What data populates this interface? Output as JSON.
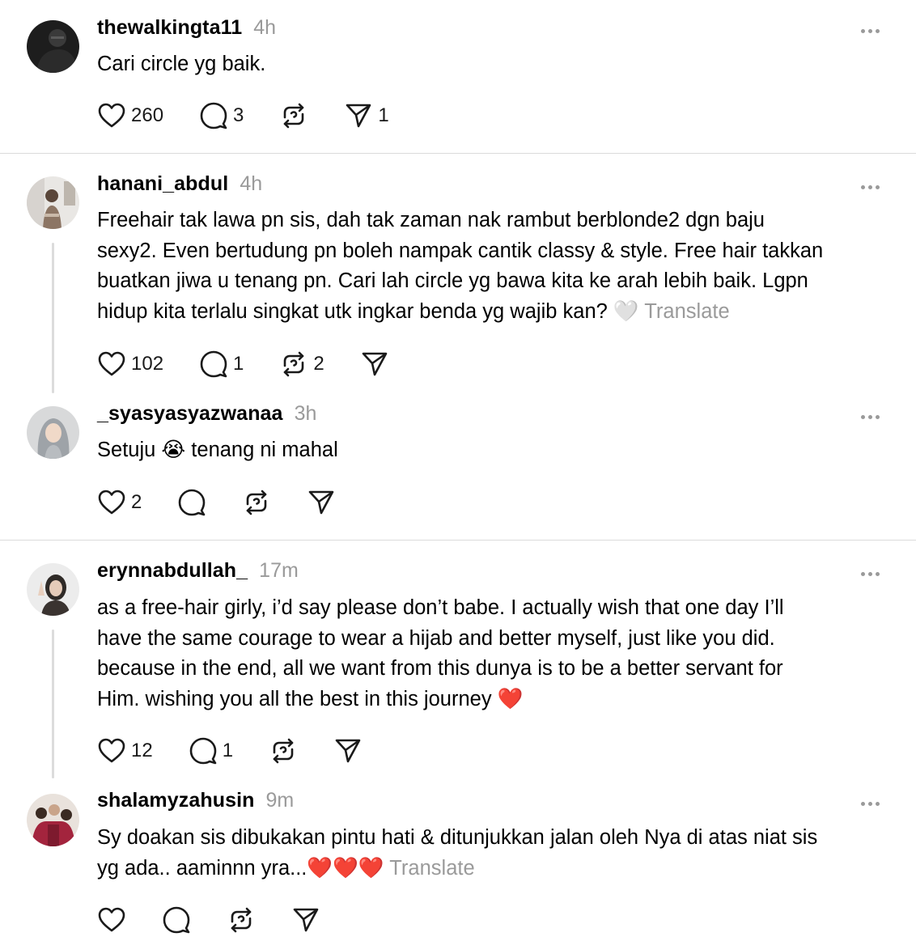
{
  "posts": [
    {
      "username": "thewalkingta11",
      "time": "4h",
      "text": "Cari circle yg baik.",
      "translate": "",
      "likes": "260",
      "replies": "3",
      "reposts": "",
      "shares": "1"
    },
    {
      "username": "hanani_abdul",
      "time": "4h",
      "text_lines": [
        "Freehair tak lawa pn sis, dah tak zaman nak rambut berblonde2 dgn baju",
        "sexy2. Even bertudung pn boleh nampak cantik classy & style. Free hair takkan",
        "buatkan jiwa u tenang pn. Cari lah circle yg bawa kita ke arah lebih baik. Lgpn",
        "hidup kita terlalu singkat utk ingkar benda yg wajib kan?"
      ],
      "emoji": "🤍",
      "translate": "Translate",
      "likes": "102",
      "replies": "1",
      "reposts": "2",
      "shares": ""
    },
    {
      "username": "_syasyasyazwanaa",
      "time": "3h",
      "text_before": "Setuju",
      "emoji": "😭",
      "text_after": "tenang ni mahal",
      "likes": "2",
      "replies": "",
      "reposts": "",
      "shares": ""
    },
    {
      "username": "erynnabdullah_",
      "time": "17m",
      "text_lines": [
        "as a free-hair girly, i’d say please don’t babe. I actually wish that one day I’ll",
        "have the same courage to wear a hijab and better myself, just like you did.",
        "because in the end, all we want from this dunya is to be a better servant for",
        "Him. wishing you all the best in this journey"
      ],
      "emoji": "❤️",
      "likes": "12",
      "replies": "1",
      "reposts": "",
      "shares": ""
    },
    {
      "username": "shalamyzahusin",
      "time": "9m",
      "text_lines": [
        "Sy doakan sis dibukakan pintu hati & ditunjukkan jalan oleh Nya di atas niat sis",
        "yg ada.. aaminnn yra..."
      ],
      "emoji": "❤️❤️❤️",
      "translate": "Translate",
      "likes": "",
      "replies": "",
      "reposts": "",
      "shares": ""
    }
  ],
  "icons": {
    "like": "heart-icon",
    "reply": "comment-icon",
    "repost": "repost-icon",
    "share": "send-icon",
    "more": "more-icon"
  },
  "colors": {
    "secondary_text": "#9a9a9a",
    "divider": "#dbdbdb",
    "thread_line": "#dcdcdc"
  }
}
